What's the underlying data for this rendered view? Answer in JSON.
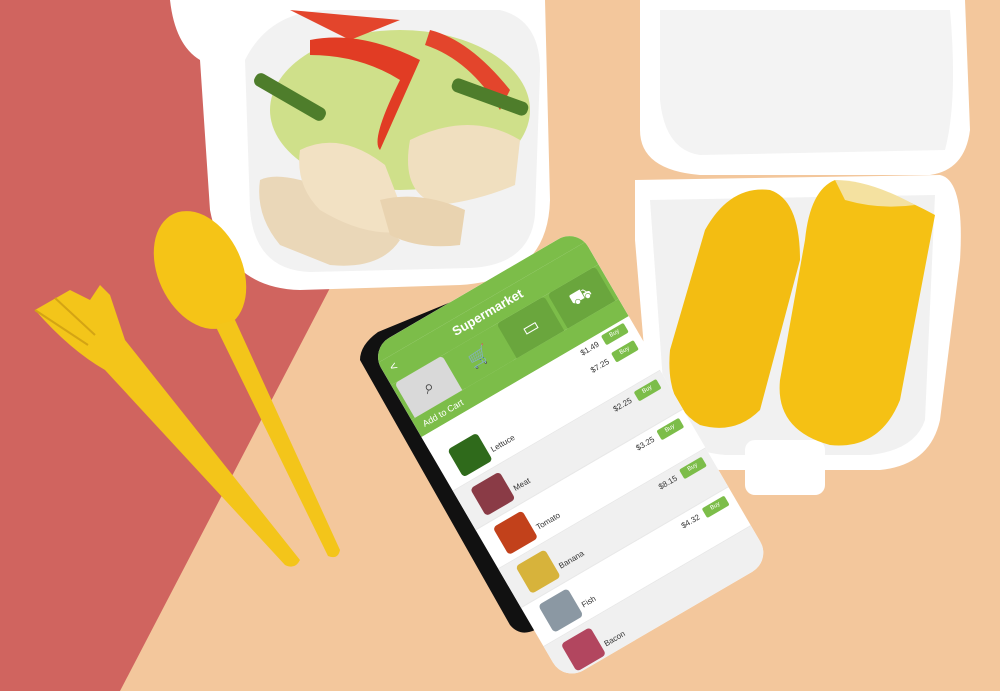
{
  "app": {
    "title": "Supermarket",
    "back_label": "<",
    "subheader": "Add to Cart",
    "tabs": [
      {
        "name": "search",
        "icon": "search-icon"
      },
      {
        "name": "cart",
        "icon": "cart-icon"
      },
      {
        "name": "card",
        "icon": "card-icon"
      },
      {
        "name": "delivery",
        "icon": "truck-icon"
      }
    ],
    "first_price": "$1.49",
    "buy_label": "Buy",
    "items": [
      {
        "name": "Lettuce",
        "price": "$7.25",
        "color": "#2f6a1b"
      },
      {
        "name": "Meat",
        "price": "$2.25",
        "color": "#8a3b46"
      },
      {
        "name": "Tomato",
        "price": "$3.25",
        "color": "#c2411b"
      },
      {
        "name": "Banana",
        "price": "$8.15",
        "color": "#d7b33b"
      },
      {
        "name": "Fish",
        "price": "$4.32",
        "color": "#8b98a3"
      },
      {
        "name": "Bacon",
        "price": "",
        "color": "#b2465f"
      }
    ]
  }
}
